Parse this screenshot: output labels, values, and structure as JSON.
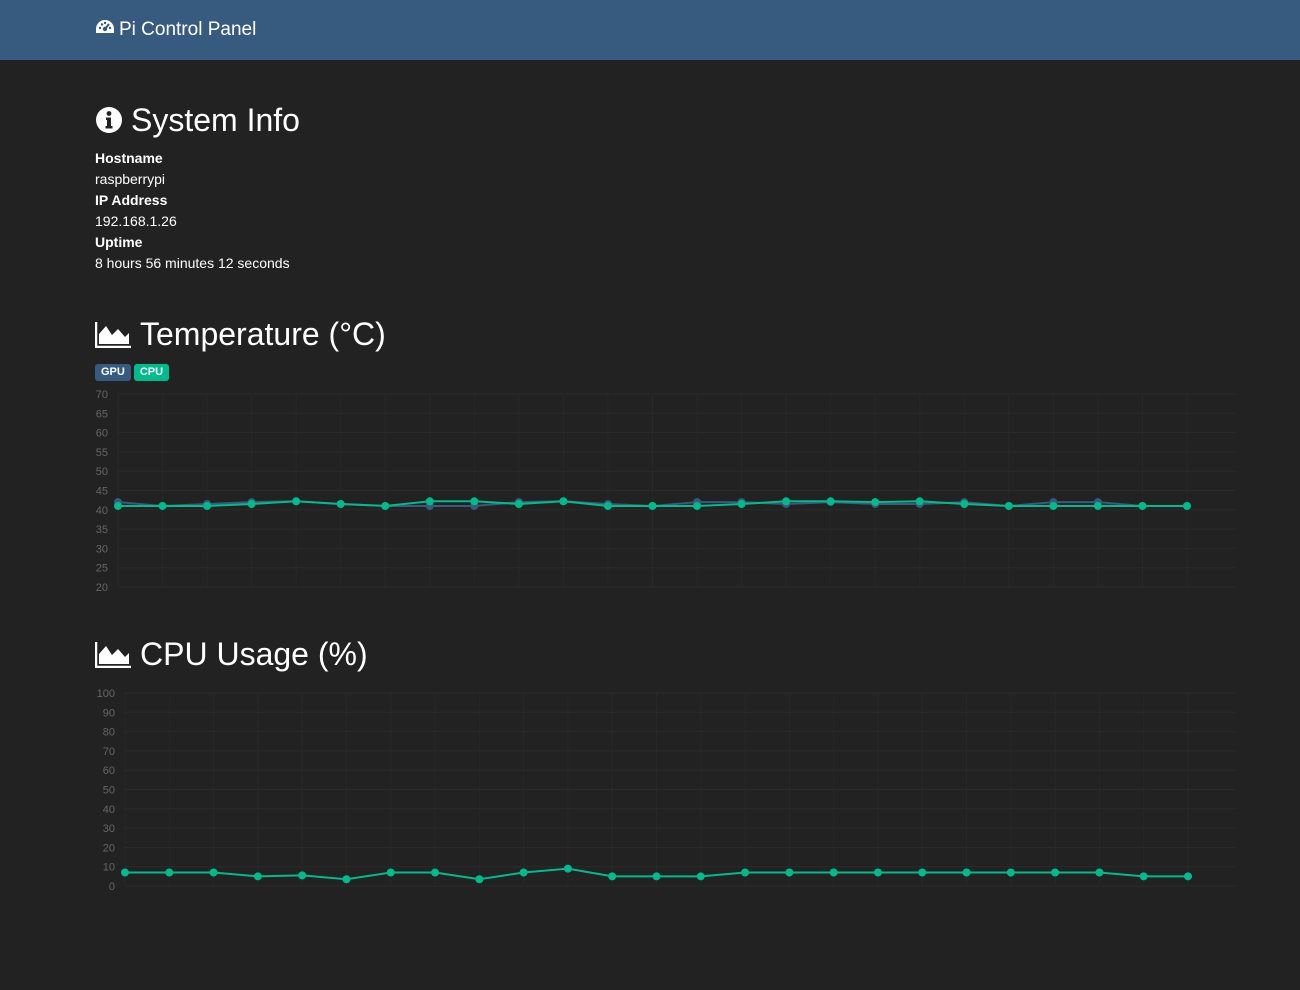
{
  "navbar": {
    "brand": "Pi Control Panel",
    "brand_icon": "dashboard-icon",
    "background": "#375a7f"
  },
  "system_info": {
    "title": "System Info",
    "icon": "info-circle-icon",
    "fields": [
      {
        "label": "Hostname",
        "value": "raspberrypi"
      },
      {
        "label": "IP Address",
        "value": "192.168.1.26"
      },
      {
        "label": "Uptime",
        "value": "8 hours 56 minutes 12 seconds"
      }
    ]
  },
  "temperature": {
    "title": "Temperature (°C)",
    "icon": "area-chart-icon",
    "legend": [
      {
        "label": "GPU",
        "color": "#375a7f"
      },
      {
        "label": "CPU",
        "color": "#00bc8c"
      }
    ]
  },
  "cpu_usage": {
    "title": "CPU Usage (%)",
    "icon": "area-chart-icon"
  },
  "chart_data": [
    {
      "type": "line",
      "title": "Temperature (°C)",
      "ylim": [
        20,
        70
      ],
      "yticks": [
        70,
        65,
        60,
        55,
        50,
        45,
        40,
        35,
        30,
        25,
        20
      ],
      "grid": true,
      "legend": "top-left",
      "series": [
        {
          "name": "GPU",
          "color": "#375a7f",
          "values": [
            42.0,
            41.0,
            41.5,
            42.0,
            42.2,
            41.5,
            41.0,
            41.0,
            41.0,
            42.0,
            42.2,
            41.5,
            41.0,
            42.0,
            42.0,
            41.5,
            42.0,
            41.5,
            41.5,
            42.0,
            41.0,
            42.0,
            42.0,
            41.0,
            41.0
          ]
        },
        {
          "name": "CPU",
          "color": "#00bc8c",
          "values": [
            41.0,
            41.0,
            41.0,
            41.5,
            42.2,
            41.5,
            41.0,
            42.2,
            42.2,
            41.5,
            42.2,
            41.0,
            41.0,
            41.0,
            41.5,
            42.2,
            42.2,
            42.0,
            42.2,
            41.5,
            41.0,
            41.0,
            41.0,
            41.0,
            41.0
          ]
        }
      ]
    },
    {
      "type": "line",
      "title": "CPU Usage (%)",
      "ylim": [
        0,
        100
      ],
      "yticks": [
        100,
        90,
        80,
        70,
        60,
        50,
        40,
        30,
        20,
        10,
        0
      ],
      "grid": true,
      "series": [
        {
          "name": "",
          "color": "#00bc8c",
          "values": [
            7,
            7,
            7,
            5,
            5.5,
            3.5,
            7,
            7,
            3.5,
            7,
            9,
            5,
            5,
            5,
            7,
            7,
            7,
            7,
            7,
            7,
            7,
            7,
            7,
            5,
            5
          ]
        }
      ]
    }
  ]
}
